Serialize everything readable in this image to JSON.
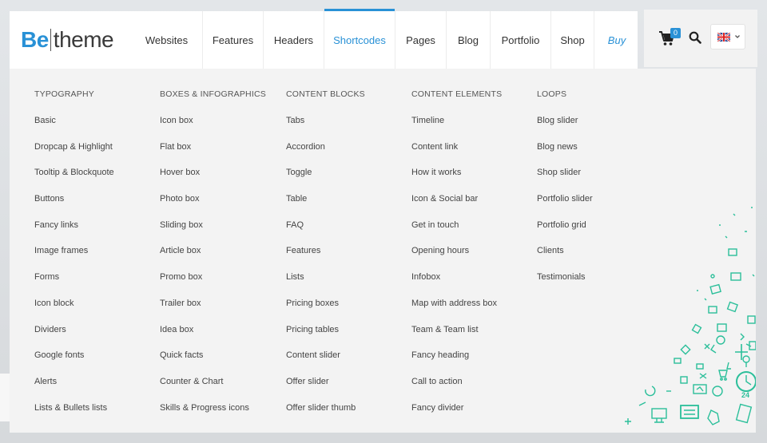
{
  "logo": {
    "part1": "Be",
    "part2": "theme"
  },
  "nav": {
    "items": [
      {
        "label": "Websites",
        "active": false
      },
      {
        "label": "Features",
        "active": false
      },
      {
        "label": "Headers",
        "active": false
      },
      {
        "label": "Shortcodes",
        "active": true
      },
      {
        "label": "Pages",
        "active": false
      },
      {
        "label": "Blog",
        "active": false
      },
      {
        "label": "Portfolio",
        "active": false
      },
      {
        "label": "Shop",
        "active": false
      },
      {
        "label": "Buy",
        "active": false
      }
    ]
  },
  "tools": {
    "cart_icon": "shopping-cart-icon",
    "cart_count": "0",
    "search_icon": "search-icon",
    "language_icon": "uk-flag-icon",
    "language_chevron": "chevron-down-icon"
  },
  "accent_color": "#2991d6",
  "mega_menu": {
    "columns": [
      {
        "heading": "TYPOGRAPHY",
        "items": [
          "Basic",
          "Dropcap & Highlight",
          "Tooltip & Blockquote",
          "Buttons",
          "Fancy links",
          "Image frames",
          "Forms",
          "Icon block",
          "Dividers",
          "Google fonts",
          "Alerts",
          "Lists & Bullets lists"
        ]
      },
      {
        "heading": "BOXES & INFOGRAPHICS",
        "items": [
          "Icon box",
          "Flat box",
          "Hover box",
          "Photo box",
          "Sliding box",
          "Article box",
          "Promo box",
          "Trailer box",
          "Idea box",
          "Quick facts",
          "Counter & Chart",
          "Skills & Progress icons"
        ]
      },
      {
        "heading": "CONTENT BLOCKS",
        "items": [
          "Tabs",
          "Accordion",
          "Toggle",
          "Table",
          "FAQ",
          "Features",
          "Lists",
          "Pricing boxes",
          "Pricing tables",
          "Content slider",
          "Offer slider",
          "Offer slider thumb"
        ]
      },
      {
        "heading": "CONTENT ELEMENTS",
        "items": [
          "Timeline",
          "Content link",
          "How it works",
          "Icon & Social bar",
          "Get in touch",
          "Opening hours",
          "Infobox",
          "Map with address box",
          "Team & Team list",
          "Fancy heading",
          "Call to action",
          "Fancy divider"
        ]
      },
      {
        "heading": "LOOPS",
        "items": [
          "Blog slider",
          "Blog news",
          "Shop slider",
          "Portfolio slider",
          "Portfolio grid",
          "Clients",
          "Testimonials"
        ]
      }
    ],
    "decoration_icon": "scattered-icons-decoration",
    "decoration_number": "24"
  }
}
